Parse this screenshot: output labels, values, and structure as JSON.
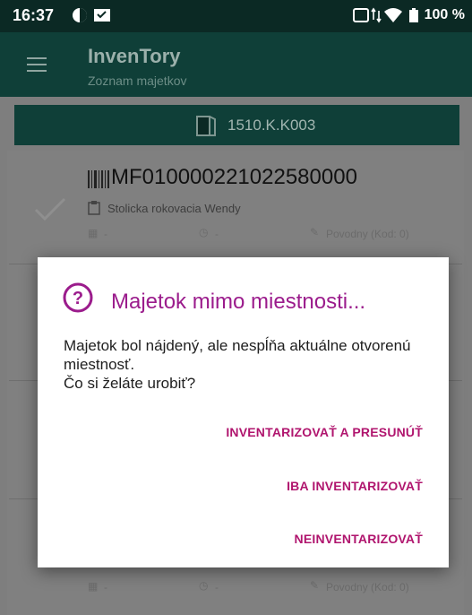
{
  "status_bar": {
    "time": "16:37",
    "battery": "100 %"
  },
  "app_bar": {
    "title": "InvenTory",
    "subtitle": "Zoznam majetkov"
  },
  "room": {
    "code": "1510.K.K003"
  },
  "list": {
    "items": [
      {
        "code": "MF010000221022580000",
        "name": "Stolicka rokovacia Wendy",
        "date": "-",
        "time": "-",
        "status": "Povodny (Kod: 0)"
      }
    ],
    "last_row": {
      "date": "-",
      "time": "-",
      "status": "Povodny (Kod: 0)"
    }
  },
  "dialog": {
    "title": "Majetok mimo miestnosti...",
    "message_line1": "Majetok bol nájdený, ale nespĺňa aktuálne otvorenú miestnosť.",
    "message_line2": "Čo si želáte urobiť?",
    "buttons": {
      "inventory_and_move": "INVENTARIZOVAŤ A PRESUNÚŤ",
      "inventory_only": "IBA INVENTARIZOVAŤ",
      "do_not_inventory": "NEINVENTARIZOVAŤ"
    }
  },
  "colors": {
    "accent": "#9b1c8c",
    "button_text": "#b0156e",
    "app_bar": "#0f3f38"
  }
}
